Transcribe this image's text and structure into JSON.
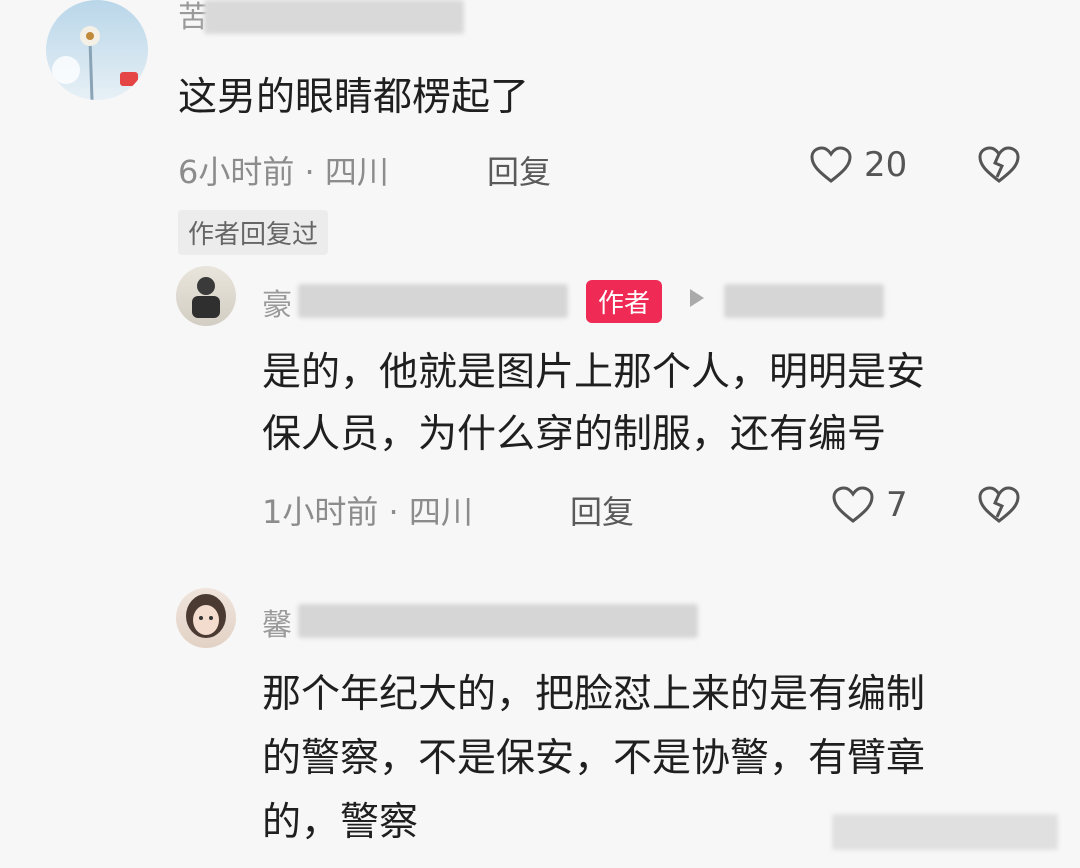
{
  "comment1": {
    "username": "苦",
    "text": "这男的眼睛都楞起了",
    "time": "6小时前",
    "location": "四川",
    "reply_label": "回复",
    "likes": "20"
  },
  "author_replied_tag": "作者回复过",
  "reply1": {
    "username_prefix": "豪",
    "badge": "作者",
    "text_line1": "是的，他就是图片上那个人，明明是安",
    "text_line2": "保人员，为什么穿的制服，还有编号",
    "time": "1小时前",
    "location": "四川",
    "reply_label": "回复",
    "likes": "7"
  },
  "reply2": {
    "username_prefix": "馨",
    "text_line1": "那个年纪大的，把脸怼上来的是有编制",
    "text_line2": "的警察，不是保安，不是协警，有臂章",
    "text_line3": "的，警察"
  },
  "colors": {
    "author_badge": "#ee2a55",
    "background": "#f7f7f7"
  }
}
